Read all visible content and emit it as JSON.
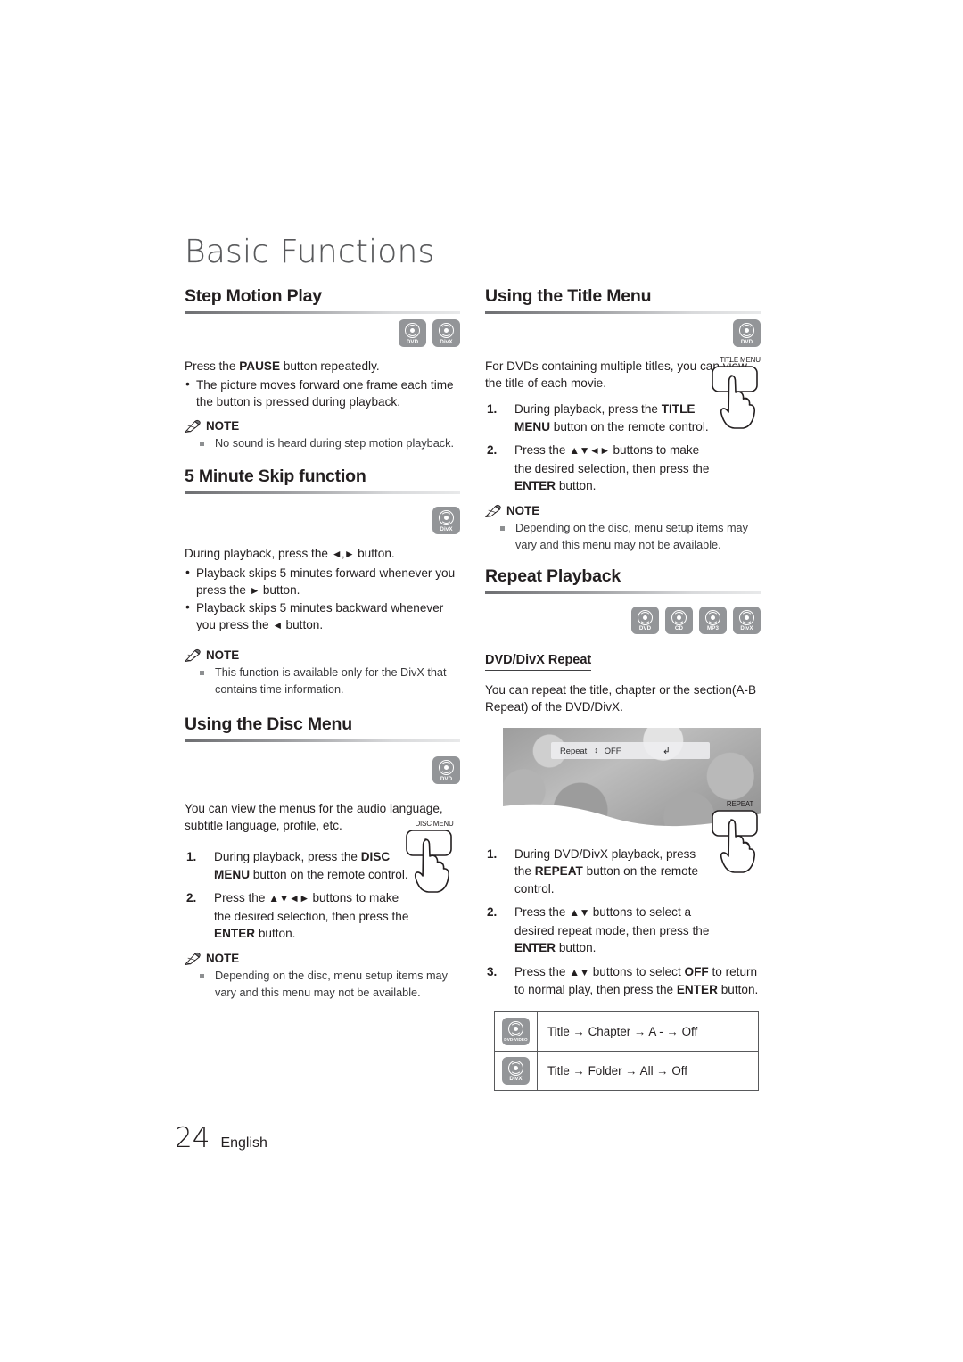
{
  "chapter": {
    "title": "Basic Functions"
  },
  "footer": {
    "page_number": "24",
    "language": "English"
  },
  "left_column": {
    "section1": {
      "heading": "Step Motion Play",
      "badges": [
        {
          "name": "dvd-badge",
          "label": "DVD"
        },
        {
          "name": "divx-badge",
          "label": "DivX"
        }
      ],
      "intro_prefix": "Press the ",
      "intro_bold": "PAUSE",
      "intro_suffix": " button repeatedly.",
      "bullets": [
        "The picture moves forward one frame each time the button is pressed during playback."
      ],
      "note_label": "NOTE",
      "notes": [
        "No sound is heard during step motion playback."
      ]
    },
    "section2": {
      "heading": "5 Minute Skip function",
      "badges": [
        {
          "name": "divx-badge",
          "label": "DivX"
        }
      ],
      "intro_prefix": "During playback, press the ",
      "intro_keys": "◄,►",
      "intro_suffix": " button.",
      "bullets": [
        {
          "pre": "Playback skips 5 minutes forward whenever you press the ",
          "key": "►",
          "post": " button."
        },
        {
          "pre": "Playback skips 5 minutes backward whenever you press the ",
          "key": "◄",
          "post": " button."
        }
      ],
      "note_label": "NOTE",
      "notes": [
        "This function is available only for the DivX that contains time information."
      ]
    },
    "section3": {
      "heading": "Using the Disc Menu",
      "badges": [
        {
          "name": "dvd-badge",
          "label": "DVD"
        }
      ],
      "intro": "You can view the menus for the audio language, subtitle language, profile, etc.",
      "remote_key_label": "DISC MENU",
      "steps": [
        {
          "num": "1.",
          "pre": "During playback, press the ",
          "bold": "DISC MENU",
          "post": " button on the remote control."
        },
        {
          "num": "2.",
          "pre": "Press the ",
          "keys": "▲▼◄►",
          "mid": " buttons to make the desired selection, then press the ",
          "bold": "ENTER",
          "post": " button."
        }
      ],
      "note_label": "NOTE",
      "notes": [
        "Depending on the disc, menu setup items may vary and this menu may not be available."
      ]
    }
  },
  "right_column": {
    "section1": {
      "heading": "Using the Title Menu",
      "badges": [
        {
          "name": "dvd-badge",
          "label": "DVD"
        }
      ],
      "intro": "For DVDs containing multiple titles, you can view the title of each movie.",
      "remote_key_label": "TITLE MENU",
      "steps": [
        {
          "num": "1.",
          "pre": "During playback, press the ",
          "bold": "TITLE MENU",
          "post": " button on the remote control."
        },
        {
          "num": "2.",
          "pre": "Press the ",
          "keys": "▲▼◄►",
          "mid": " buttons to make the desired selection, then press the ",
          "bold": "ENTER",
          "post": " button."
        }
      ],
      "note_label": "NOTE",
      "notes": [
        "Depending on the disc, menu setup items may vary and this menu may not be available."
      ]
    },
    "section2": {
      "heading": "Repeat Playback",
      "badges": [
        {
          "name": "dvd-badge",
          "label": "DVD"
        },
        {
          "name": "cd-badge",
          "label": "CD"
        },
        {
          "name": "mp3-badge",
          "label": "MP3"
        },
        {
          "name": "divx-badge",
          "label": "DivX"
        }
      ],
      "subheading": "DVD/DivX Repeat",
      "intro": "You can repeat the title, chapter or the section(A-B Repeat) of the DVD/DivX.",
      "osd": {
        "label": "Repeat",
        "updown_icon": "↕",
        "value": "OFF",
        "return_icon": "↲"
      },
      "remote_key_label": "REPEAT",
      "steps": [
        {
          "num": "1.",
          "pre": "During DVD/DivX playback, press the ",
          "bold": "REPEAT",
          "post": " button on the remote control."
        },
        {
          "num": "2.",
          "pre": "Press the ",
          "keys": "▲▼",
          "mid": " buttons to select a desired repeat mode, then press the ",
          "bold": "ENTER",
          "post": " button."
        },
        {
          "num": "3.",
          "pre": "Press the ",
          "keys": "▲▼",
          "mid": " buttons to select ",
          "bold": "OFF",
          "post": " to return to normal play, then press the ",
          "bold2": "ENTER",
          "post2": " button."
        }
      ],
      "modes_table": [
        {
          "icon_label": "DVD-VIDEO",
          "sequence": "Title → Chapter → A - → Off"
        },
        {
          "icon_label": "DivX",
          "sequence": "Title → Folder → All → Off"
        }
      ]
    }
  }
}
